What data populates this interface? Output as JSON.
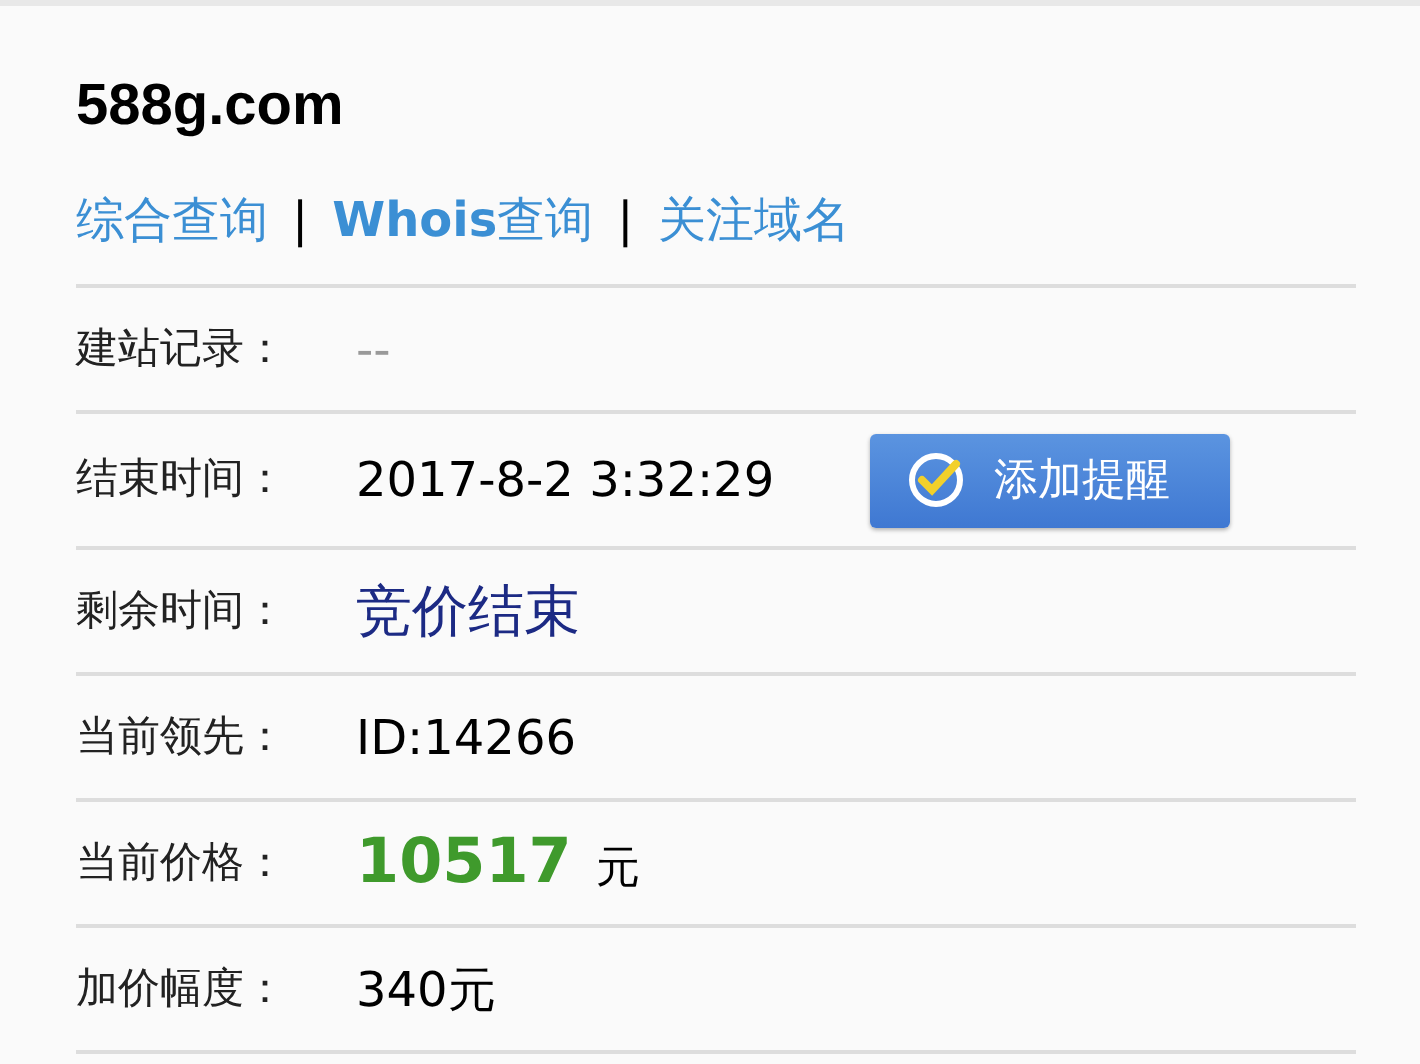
{
  "domain": "588g.com",
  "links": [
    {
      "label": "综合查询"
    },
    {
      "label": "**Whois**查询"
    },
    {
      "label": "关注域名"
    }
  ],
  "separators": [
    "|",
    "|"
  ],
  "rows": [
    {
      "label": "建站记录：",
      "kind": "muted",
      "value": "--"
    },
    {
      "label": "结束时间：",
      "kind": "plain",
      "value": "2017-8-2 3:32:29",
      "button": "添加提醒"
    },
    {
      "label": "剩余时间：",
      "kind": "status",
      "value": "竞价结束"
    },
    {
      "label": "当前领先：",
      "kind": "plain",
      "value": "ID:14266"
    },
    {
      "label": "当前价格：",
      "kind": "price",
      "value": "10517",
      "unit": "元"
    },
    {
      "label": "加价幅度：",
      "kind": "plain",
      "value": "340元"
    }
  ]
}
